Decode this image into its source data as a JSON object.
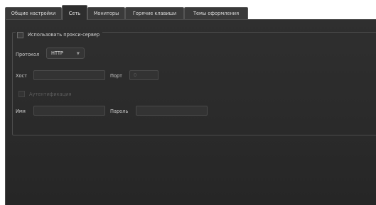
{
  "tabs": [
    {
      "label": "Общие настройки",
      "active": false
    },
    {
      "label": "Сеть",
      "active": true
    },
    {
      "label": "Мониторы",
      "active": false
    },
    {
      "label": "Горячие клавиши",
      "active": false
    },
    {
      "label": "Темы оформления",
      "active": false
    }
  ],
  "proxy": {
    "use_proxy_label": "Использовать прокси-сервер",
    "use_proxy_checked": false,
    "protocol_label": "Протокол",
    "protocol_value": "HTTP",
    "host_label": "Хост",
    "host_value": "",
    "port_label": "Порт",
    "port_value": "0",
    "auth_label": "Аутентификация",
    "auth_checked": false,
    "name_label": "Имя",
    "name_value": "",
    "password_label": "Пароль",
    "password_value": ""
  },
  "icons": {
    "dropdown": "chevron-down-icon"
  }
}
